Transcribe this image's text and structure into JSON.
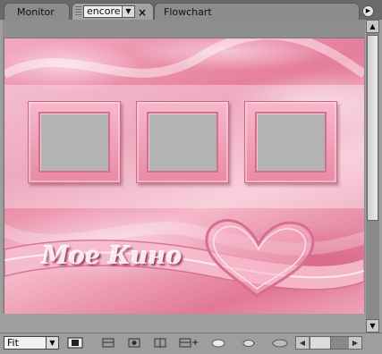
{
  "tabs": [
    {
      "label": "Monitor"
    },
    {
      "label": "encore",
      "dropdown": "▼",
      "close": "×"
    },
    {
      "label": "Flowchart"
    }
  ],
  "panel_menu_icon": "▶",
  "menu": {
    "title": "Мое Кино",
    "button_count": 3
  },
  "toolbar": {
    "zoom_value": "Fit",
    "zoom_arrow": "▼",
    "tools": [
      "safe-area-icon",
      "button-routing-icon",
      "show-routing-icon",
      "add-button-icon",
      "add-text-icon",
      "link-icon",
      "chain-icon",
      "grid-icon"
    ]
  },
  "scroll": {
    "up": "▲",
    "down": "▼",
    "left": "◀",
    "right": "▶"
  },
  "colors": {
    "pink": "#ee93ad",
    "frame_inner": "#b3b3b3",
    "chrome": "#9e9e9e"
  }
}
